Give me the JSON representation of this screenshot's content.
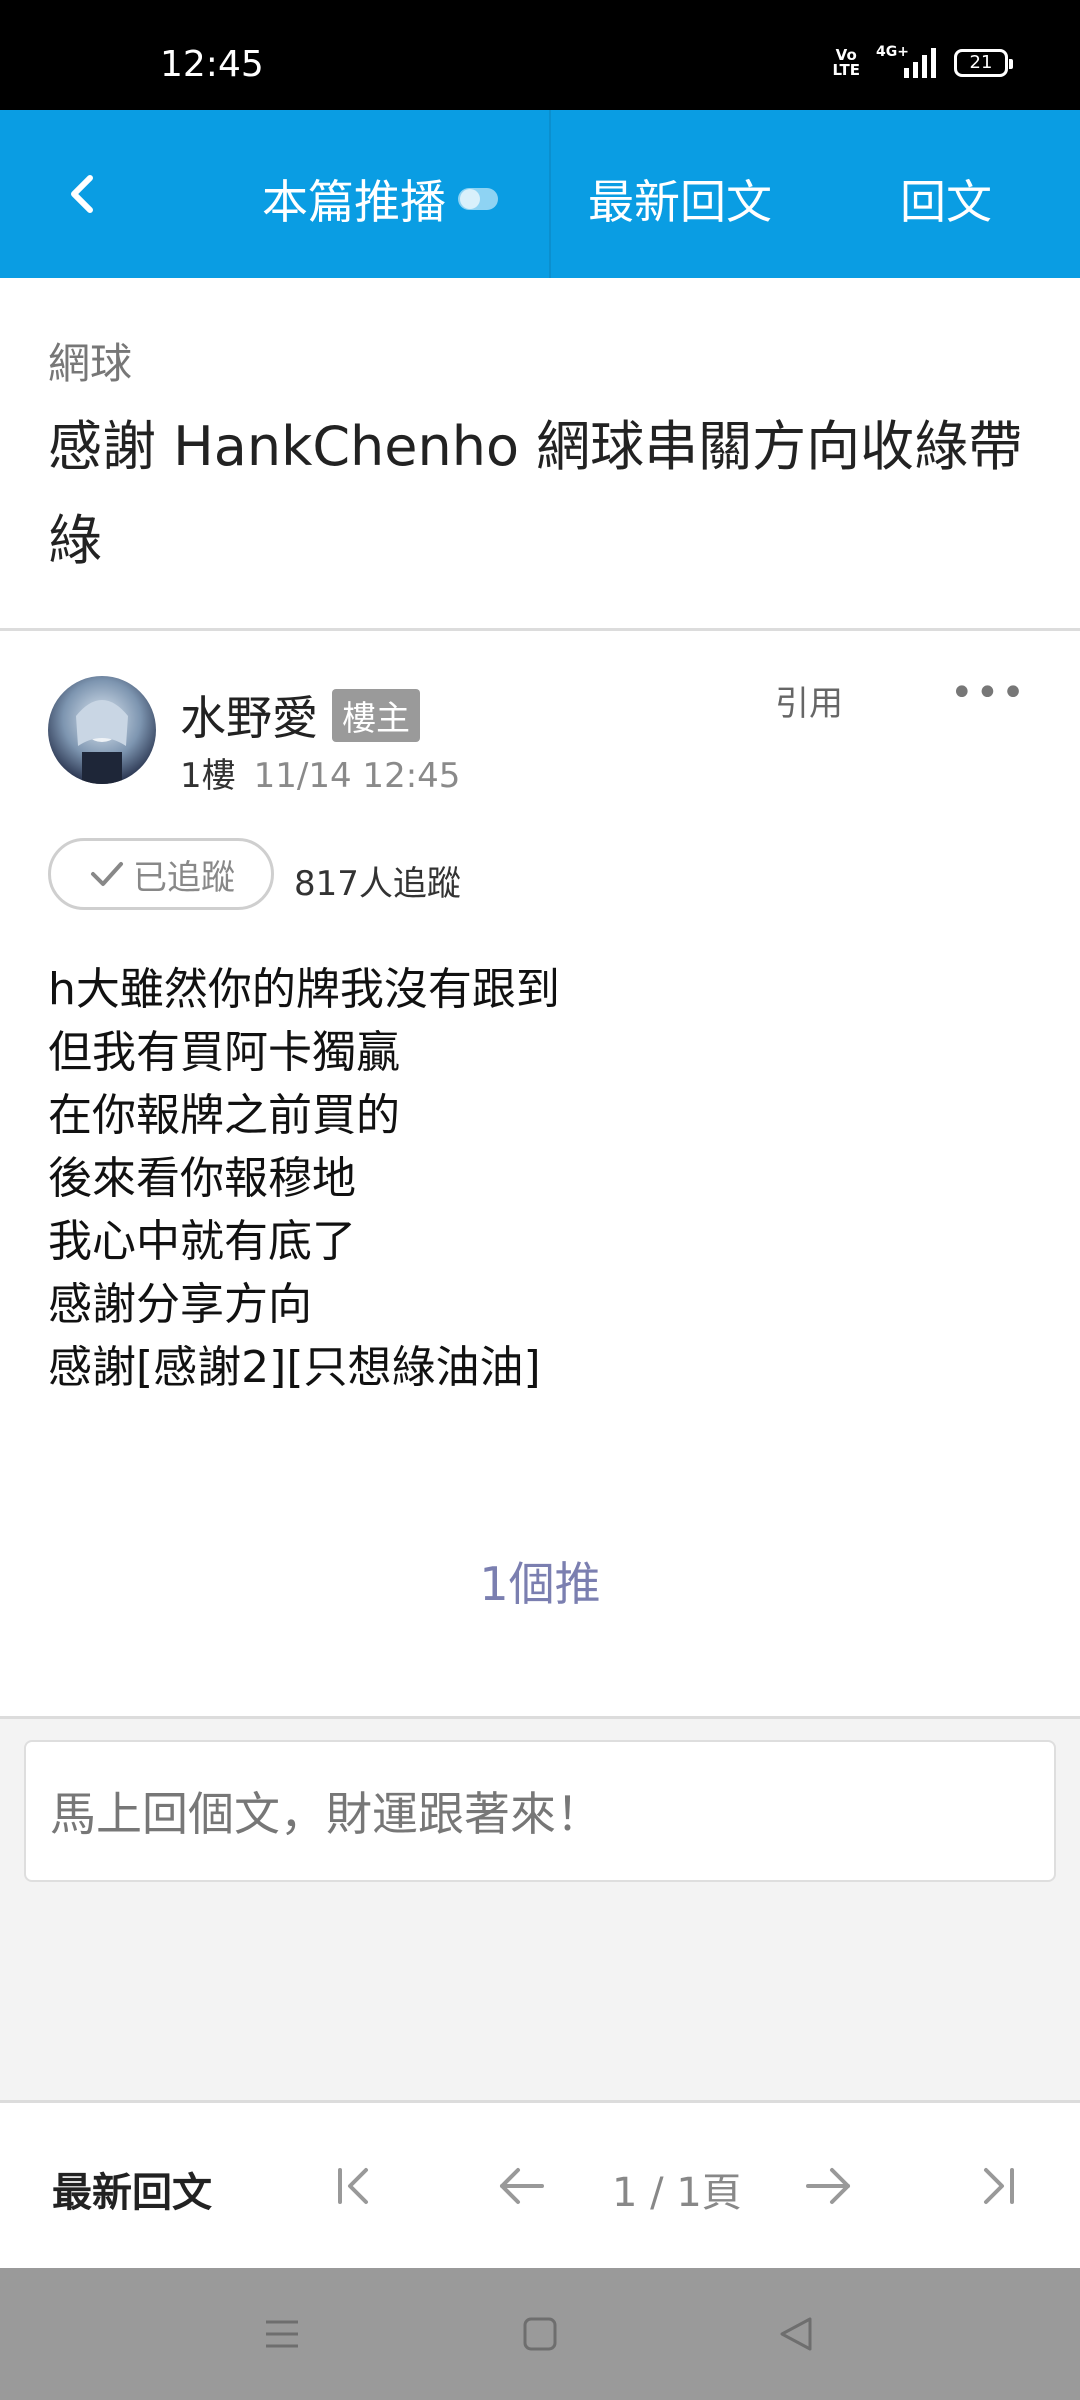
{
  "status_bar": {
    "time": "12:45",
    "volte": "Vo\nLTE",
    "network": "4G+",
    "battery": "21"
  },
  "header": {
    "back_icon": "chevron-left-icon",
    "tabs": {
      "push": "本篇推播",
      "latest": "最新回文",
      "reply": "回文"
    }
  },
  "thread": {
    "board": "網球",
    "title": "感謝 HankChenho 網球串關方向收綠帶綠"
  },
  "post": {
    "author": "水野愛",
    "owner_badge": "樓主",
    "floor": "1樓",
    "datetime": "11/14 12:45",
    "quote_label": "引用",
    "more_label": "•••",
    "follow_label": "已追蹤",
    "follow_count": "817人追蹤",
    "lines": [
      "h大雖然你的牌我沒有跟到",
      "但我有買阿卡獨贏",
      "在你報牌之前買的",
      "後來看你報穆地",
      "我心中就有底了",
      "感謝分享方向",
      "感謝[感謝2][只想綠油油]"
    ],
    "push_count": "1個推"
  },
  "reply": {
    "placeholder": "馬上回個文，財運跟著來！"
  },
  "pager": {
    "latest_label": "最新回文",
    "page_indicator": "1 / 1頁"
  },
  "colors": {
    "accent": "#0a9de3",
    "push_count": "#7b7fb0"
  }
}
